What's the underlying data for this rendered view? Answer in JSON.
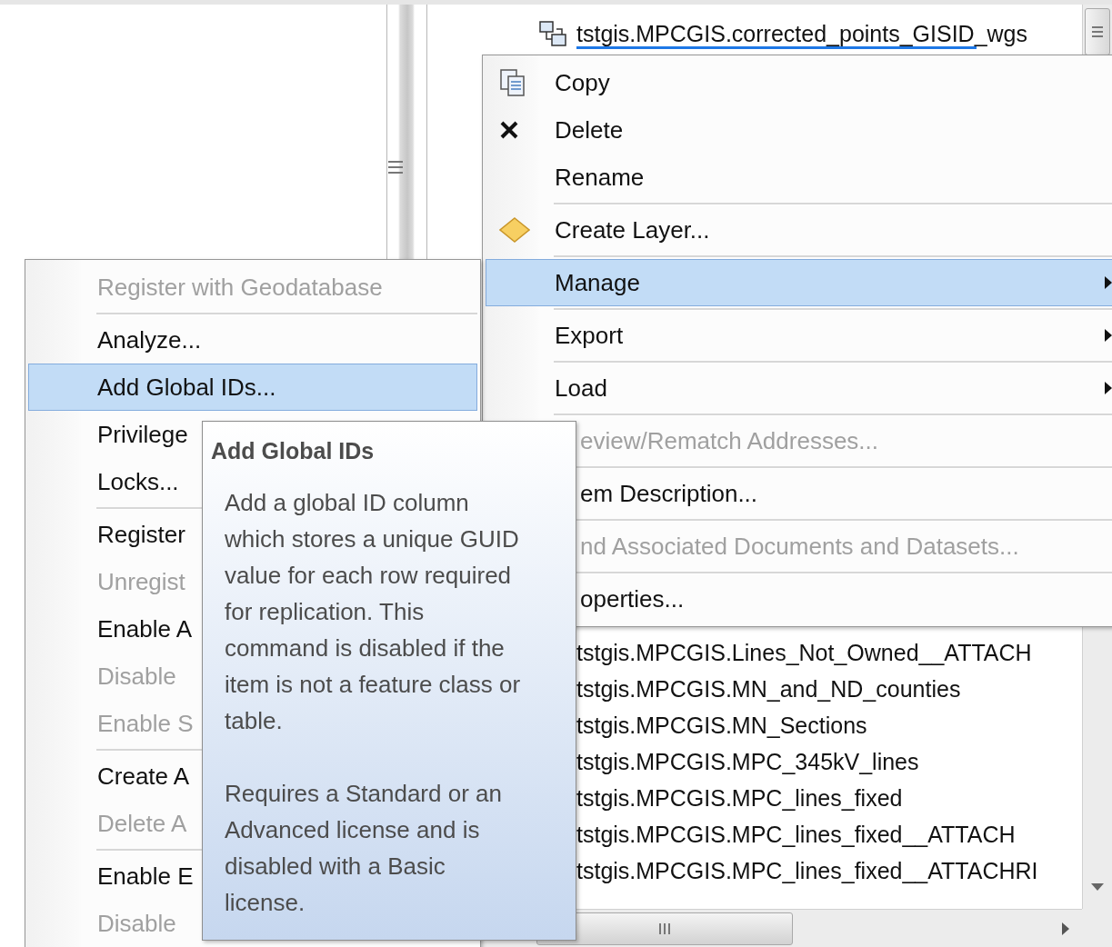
{
  "tree": {
    "top_item": {
      "label": "tstgis.MPCGIS.corrected_points_GISID_wgs",
      "kind": "relationship",
      "selected": true
    },
    "items": [
      {
        "label": "tstgis.MPCGIS.Lines_Not_Owned__ATTACH",
        "selected": false
      },
      {
        "label": "tstgis.MPCGIS.MN_and_ND_counties",
        "selected": false
      },
      {
        "label": "tstgis.MPCGIS.MN_Sections",
        "selected": false
      },
      {
        "label": "tstgis.MPCGIS.MPC_345kV_lines",
        "selected": false
      },
      {
        "label": "tstgis.MPCGIS.MPC_lines_fixed",
        "selected": false
      },
      {
        "label": "tstgis.MPCGIS.MPC_lines_fixed__ATTACH",
        "selected": false
      },
      {
        "label": "tstgis.MPCGIS.MPC_lines_fixed__ATTACHRI",
        "selected": false
      }
    ]
  },
  "context_menu": {
    "items": [
      {
        "kind": "copy",
        "label": "Copy",
        "disabled": false,
        "selected": false,
        "submenu": false,
        "cut": false
      },
      {
        "kind": "delete",
        "label": "Delete",
        "disabled": false,
        "selected": false,
        "submenu": false,
        "cut": false
      },
      {
        "kind": "plain",
        "label": "Rename",
        "disabled": false,
        "selected": false,
        "submenu": false,
        "cut": false
      },
      {
        "kind": "separator"
      },
      {
        "kind": "layer",
        "label": "Create Layer...",
        "disabled": false,
        "selected": false,
        "submenu": false,
        "cut": false
      },
      {
        "kind": "separator"
      },
      {
        "kind": "plain",
        "label": "Manage",
        "disabled": false,
        "selected": true,
        "submenu": true,
        "cut": false
      },
      {
        "kind": "separator"
      },
      {
        "kind": "plain",
        "label": "Export",
        "disabled": false,
        "selected": false,
        "submenu": true,
        "cut": false
      },
      {
        "kind": "separator"
      },
      {
        "kind": "plain",
        "label": "Load",
        "disabled": false,
        "selected": false,
        "submenu": true,
        "cut": false
      },
      {
        "kind": "separator"
      },
      {
        "kind": "plain",
        "label": "eview/Rematch Addresses...",
        "disabled": true,
        "selected": false,
        "submenu": false,
        "cut": true
      },
      {
        "kind": "separator"
      },
      {
        "kind": "plain",
        "label": "em Description...",
        "disabled": false,
        "selected": false,
        "submenu": false,
        "cut": true
      },
      {
        "kind": "separator"
      },
      {
        "kind": "plain",
        "label": "nd Associated Documents and Datasets...",
        "disabled": true,
        "selected": false,
        "submenu": false,
        "cut": true
      },
      {
        "kind": "separator"
      },
      {
        "kind": "plain",
        "label": "operties...",
        "disabled": false,
        "selected": false,
        "submenu": false,
        "cut": true
      }
    ]
  },
  "manage_submenu": {
    "items": [
      {
        "kind": "plain",
        "label": "Register with Geodatabase",
        "disabled": true,
        "selected": false
      },
      {
        "kind": "separator"
      },
      {
        "kind": "plain",
        "label": "Analyze...",
        "disabled": false,
        "selected": false
      },
      {
        "kind": "plain",
        "label": "Add Global IDs...",
        "disabled": false,
        "selected": true
      },
      {
        "kind": "plain",
        "label": "Privilege",
        "disabled": false,
        "selected": false
      },
      {
        "kind": "plain",
        "label": "Locks...",
        "disabled": false,
        "selected": false
      },
      {
        "kind": "separator"
      },
      {
        "kind": "plain",
        "label": "Register",
        "disabled": false,
        "selected": false
      },
      {
        "kind": "plain",
        "label": "Unregist",
        "disabled": true,
        "selected": false
      },
      {
        "kind": "plain",
        "label": "Enable A",
        "disabled": false,
        "selected": false
      },
      {
        "kind": "plain",
        "label": "Disable",
        "disabled": true,
        "selected": false
      },
      {
        "kind": "plain",
        "label": "Enable S",
        "disabled": true,
        "selected": false
      },
      {
        "kind": "separator"
      },
      {
        "kind": "plain",
        "label": "Create A",
        "disabled": false,
        "selected": false
      },
      {
        "kind": "plain",
        "label": "Delete A",
        "disabled": true,
        "selected": false
      },
      {
        "kind": "separator"
      },
      {
        "kind": "plain",
        "label": "Enable E",
        "disabled": false,
        "selected": false
      },
      {
        "kind": "plain",
        "label": "Disable",
        "disabled": true,
        "selected": false
      }
    ]
  },
  "tooltip": {
    "title": "Add Global IDs",
    "paragraphs": [
      "Add a global ID column which stores a unique GUID value for each row required for replication. This command is disabled if the item is not a feature class or table.",
      "Requires a Standard or an Advanced license and is disabled with a Basic license."
    ]
  }
}
